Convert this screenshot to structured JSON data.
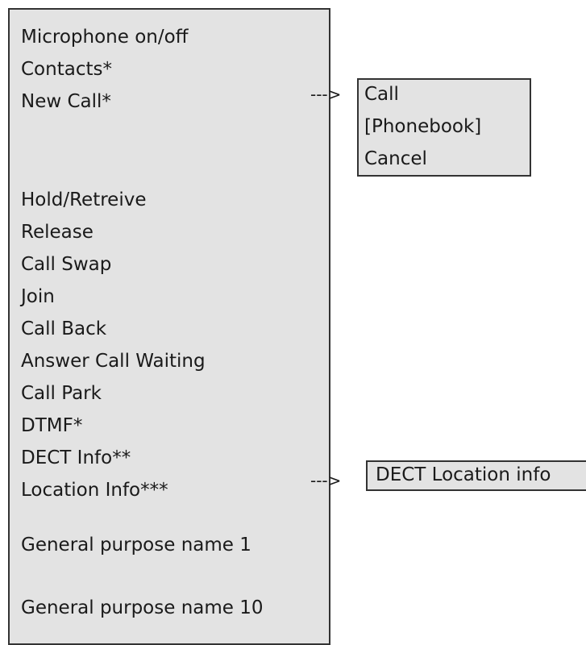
{
  "main_menu": {
    "items": [
      "Microphone on/off",
      "Contacts*",
      "New Call*",
      "Hold/Retreive",
      "Release",
      "Call Swap",
      "Join",
      "Call Back",
      "Answer Call Waiting",
      "Call Park",
      "DTMF*",
      "DECT Info**",
      "Location Info***",
      "General purpose name 1",
      "General purpose name 10"
    ]
  },
  "new_call_submenu": {
    "arrow": "--->",
    "items": [
      "Call",
      "[Phonebook]",
      "Cancel"
    ]
  },
  "location_submenu": {
    "arrow": "--->",
    "items": [
      "DECT Location info"
    ]
  }
}
